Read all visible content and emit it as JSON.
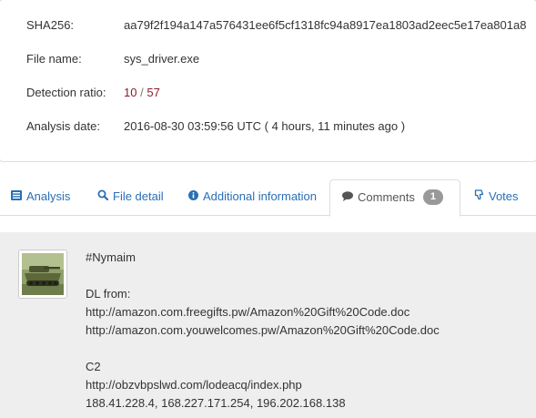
{
  "summary": {
    "sha256_label": "SHA256:",
    "sha256_value": "aa79f2f194a147a576431ee6f5cf1318fc94a8917ea1803ad2eec5e17ea801a8",
    "filename_label": "File name:",
    "filename_value": "sys_driver.exe",
    "ratio_label": "Detection ratio:",
    "ratio_detected": "10",
    "ratio_separator": "/",
    "ratio_total": "57",
    "date_label": "Analysis date:",
    "date_value": "2016-08-30 03:59:56 UTC ( 4 hours, 11 minutes ago )"
  },
  "tabs": [
    {
      "label": "Analysis",
      "icon": "list-icon",
      "active": false
    },
    {
      "label": "File detail",
      "icon": "search-icon",
      "active": false
    },
    {
      "label": "Additional information",
      "icon": "info-circle-icon",
      "active": false
    },
    {
      "label": "Comments",
      "icon": "comment-icon",
      "active": true,
      "badge": "1"
    },
    {
      "label": "Votes",
      "icon": "thumbs-icon",
      "active": false
    }
  ],
  "comment": {
    "avatar_icon": "tank-photo",
    "lines": {
      "tag": "#Nymaim",
      "dl_heading": "DL from:",
      "dl_url_1": "http://amazon.com.freegifts.pw/Amazon%20Gift%20Code.doc",
      "dl_url_2": "http://amazon.com.youwelcomes.pw/Amazon%20Gift%20Code.doc",
      "c2_heading": "C2",
      "c2_url": "http://obzvbpslwd.com/lodeacq/index.php",
      "c2_ips": "188.41.228.4, 168.227.171.254, 196.202.168.138"
    }
  },
  "colors": {
    "link": "#2a6fb5",
    "ratio": "#8a1c2b",
    "badge": "#999999",
    "comments_bg": "#eeeeee"
  }
}
